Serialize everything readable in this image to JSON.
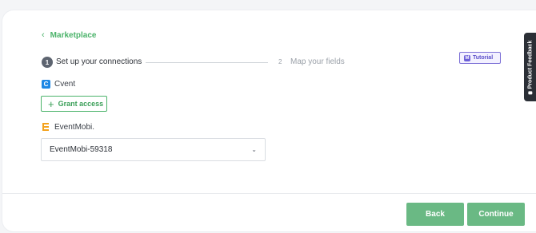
{
  "nav": {
    "back_label": "Marketplace",
    "back_icon": "chevron-left-icon"
  },
  "stepper": {
    "steps": [
      {
        "number": "1",
        "label": "Set up your connections",
        "state": "active"
      },
      {
        "number": "2",
        "label": "Map your fields",
        "state": "inactive"
      }
    ]
  },
  "tutorial": {
    "label": "Tutorial",
    "icon_glyph": "M"
  },
  "connections": {
    "cvent": {
      "name": "Cvent",
      "logo_glyph": "C",
      "grant_label": "Grant access"
    },
    "eventmobi": {
      "name": "EventMobi.",
      "selected_account": "EventMobi-59318"
    }
  },
  "footer": {
    "back_label": "Back",
    "continue_label": "Continue"
  },
  "feedback": {
    "label": "Product Feedback"
  },
  "colors": {
    "accent": "#4bb36a",
    "button": "#6ab984",
    "tutorial": "#5b4ec9",
    "feedback_bg": "#2b2f36"
  }
}
